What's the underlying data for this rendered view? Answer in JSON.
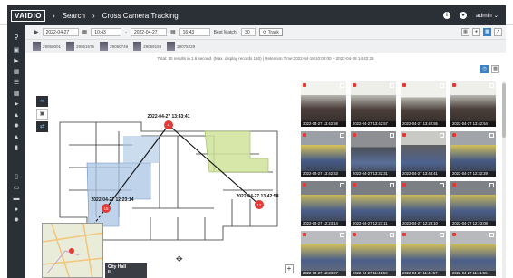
{
  "header": {
    "logo": "VAIDIO",
    "breadcrumb": [
      "Search",
      "Cross Camera Tracking"
    ],
    "user": "admin",
    "help_icon": "info-icon",
    "globe_icon": "globe-icon"
  },
  "sidebar": {
    "items": [
      "search-icon",
      "camera-icon",
      "video-icon",
      "image-icon",
      "ruler-icon",
      "chart-icon",
      "run-icon",
      "alert-icon",
      "gear-icon",
      "bell-icon",
      "report-icon",
      "file-icon",
      "monitor-icon",
      "card-icon",
      "user-icon",
      "settings-icon"
    ]
  },
  "toolbar": {
    "start_date": "2022-04-27",
    "start_time": "10:43",
    "to_sep": "-",
    "end_date": "2022-04-27",
    "end_time": "16:43",
    "best_match_label": "Best Match:",
    "best_match_value": "30",
    "track_button": "Track"
  },
  "chips": [
    "29050001",
    "29051676",
    "29050749",
    "29069159",
    "29075229"
  ],
  "info_text": "Total: 30 results in 1.6 second. (Max. display records 150) | Retention Time:2022-04-18 10:00:00 ~ 2022-04-28 14:42:26",
  "map": {
    "markers": [
      {
        "id": "4",
        "label": "2022-04-27 13:43:41"
      },
      {
        "id": "15",
        "label": "2022-04-27 12:23:14"
      },
      {
        "id": "12",
        "label": "2022-04-27 13:42:58"
      }
    ],
    "minimap_label": "City Hall",
    "minimap_sub": "lll"
  },
  "gallery": {
    "tiles": [
      "2022-04-27 13:42:58",
      "2022-04-27 13:42:57",
      "2022-04-27 13:42:55",
      "2022-04-27 13:42:54",
      "2022-04-27 13:42:53",
      "2022-04-27 13:32:31",
      "2022-04-27 13:43:41",
      "2022-04-27 12:32:29",
      "2022-04-27 12:23:14",
      "2022-04-27 12:23:11",
      "2022-04-27 12:23:10",
      "2022-04-27 12:23:08",
      "2022-04-27 12:23:07",
      "2022-04-27 11:41:58",
      "2022-04-27 11:41:57",
      "2022-04-27 11:41:55"
    ]
  },
  "colors": {
    "accent": "#3b82c4",
    "topbar": "#2b2f36",
    "marker": "#e53935",
    "zone_blue": "#a9c4e4",
    "zone_green": "#cfe39a"
  }
}
